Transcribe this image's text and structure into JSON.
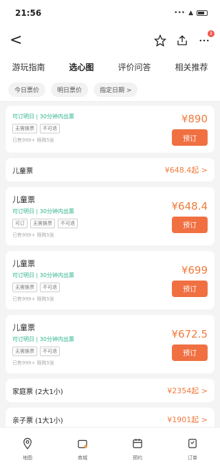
{
  "status": {
    "time": "21:56",
    "signal": "•••"
  },
  "nav": {
    "back": "<",
    "badge": "3"
  },
  "tabs": [
    "游玩指南",
    "选心图",
    "评价问答",
    "相关推荐"
  ],
  "filters": [
    "今日票价",
    "明日票价",
    "指定日期 >"
  ],
  "colors": {
    "accent": "#f07042",
    "green": "#2bb38b"
  },
  "cards_top": {
    "green": "可订明日 | 30分钟内出票",
    "tags": [
      "无需换票",
      "不可退"
    ],
    "meta": "已售999+ 限购5张",
    "price": "¥890",
    "button": "预订"
  },
  "row1": {
    "label": "儿童票",
    "price": "¥648.4起 >"
  },
  "cards": [
    {
      "name": "儿童票",
      "green": "可订明日 | 30分钟内出票",
      "tags": [
        "可订",
        "无需换票",
        "不可退"
      ],
      "meta": "已售999+ 限购5张",
      "price": "¥648.4",
      "button": "预订"
    },
    {
      "name": "儿童票",
      "green": "可订明日 | 30分钟内出票",
      "tags": [
        "无需换票",
        "不可退"
      ],
      "meta": "已售999+ 限购5张",
      "price": "¥699",
      "button": "预订"
    },
    {
      "name": "儿童票",
      "green": "可订明日 | 30分钟内出票",
      "tags": [
        "无需换票",
        "不可退"
      ],
      "meta": "已售999+ 限购5张",
      "price": "¥672.5",
      "button": "预订"
    }
  ],
  "rows_bottom": [
    {
      "label": "家庭票 (2大1小)",
      "price": "¥2354起 >"
    },
    {
      "label": "亲子票 (1大1小)",
      "price": "¥1901起 >"
    }
  ],
  "bottom_nav": [
    "地图",
    "商城",
    "预约",
    "订单"
  ]
}
